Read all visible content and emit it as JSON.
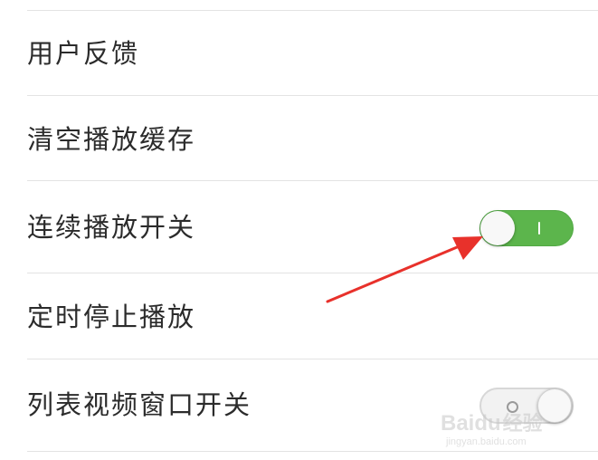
{
  "settings": {
    "items": [
      {
        "label": "用户反馈"
      },
      {
        "label": "清空播放缓存"
      },
      {
        "label": "连续播放开关",
        "toggle": "on"
      },
      {
        "label": "定时停止播放"
      },
      {
        "label": "列表视频窗口开关",
        "toggle": "off"
      }
    ]
  },
  "colors": {
    "toggle_on": "#5cb54c",
    "toggle_off": "#f2f2f2",
    "annotation_arrow": "#e8312b",
    "divider": "#e3e3e3",
    "text": "#2b2b2b"
  },
  "watermark": {
    "brand": "Baidu",
    "suffix": "经验",
    "url": "jingyan.baidu.com"
  }
}
